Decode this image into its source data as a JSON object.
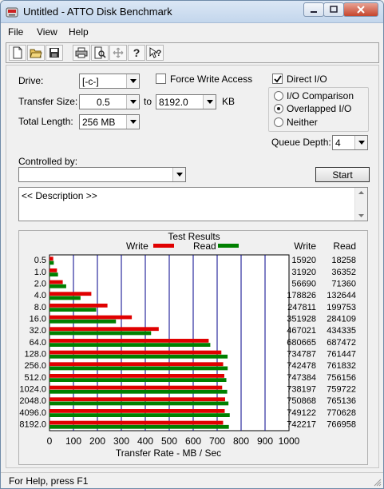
{
  "window": {
    "title": "Untitled - ATTO Disk Benchmark"
  },
  "menu": {
    "file": "File",
    "view": "View",
    "help": "Help"
  },
  "toolbar": {
    "buttons": [
      "new-document-icon",
      "open-folder-icon",
      "save-icon",
      "print-icon",
      "print-preview-icon",
      "move-icon",
      "help-icon",
      "context-help-icon"
    ]
  },
  "settings": {
    "drive_label": "Drive:",
    "drive_value": "[-c-]",
    "force_write_label": "Force Write Access",
    "force_write_checked": false,
    "direct_io_label": "Direct I/O",
    "direct_io_checked": true,
    "transfer_size_label": "Transfer Size:",
    "transfer_from": "0.5",
    "to_label": "to",
    "transfer_to": "8192.0",
    "kb_label": "KB",
    "total_length_label": "Total Length:",
    "total_length_value": "256 MB",
    "io_comparison_label": "I/O Comparison",
    "overlapped_io_label": "Overlapped I/O",
    "neither_label": "Neither",
    "selected_mode": "Overlapped I/O",
    "queue_depth_label": "Queue Depth:",
    "queue_depth_value": "4",
    "controlled_by_label": "Controlled by:",
    "controlled_by_value": "",
    "start_label": "Start",
    "description": "<< Description >>"
  },
  "results": {
    "title": "Test Results",
    "legend_write": "Write",
    "legend_read": "Read",
    "col_write": "Write",
    "col_read": "Read",
    "write_color": "#e00000",
    "read_color": "#008000"
  },
  "chart_data": {
    "type": "bar",
    "title": "Test Results",
    "xlabel": "Transfer Rate - MB / Sec",
    "ylabel": "",
    "xlim": [
      0,
      1000
    ],
    "xticks": [
      "0",
      "100",
      "200",
      "300",
      "400",
      "500",
      "600",
      "700",
      "800",
      "900",
      "1000"
    ],
    "categories": [
      "0.5",
      "1.0",
      "2.0",
      "4.0",
      "8.0",
      "16.0",
      "32.0",
      "64.0",
      "128.0",
      "256.0",
      "512.0",
      "1024.0",
      "2048.0",
      "4096.0",
      "8192.0"
    ],
    "series": [
      {
        "name": "Write",
        "values": [
          15920,
          31920,
          56690,
          178826,
          247811,
          351928,
          467021,
          680665,
          734787,
          742478,
          747384,
          738197,
          750868,
          749122,
          742217
        ]
      },
      {
        "name": "Read",
        "values": [
          18258,
          36352,
          71360,
          132644,
          199753,
          284109,
          434335,
          687472,
          761447,
          761832,
          756156,
          759722,
          765136,
          770628,
          766958
        ]
      }
    ],
    "value_unit_note": "",
    "grid": true,
    "legend": "top"
  },
  "status": {
    "text": "For Help, press F1"
  }
}
